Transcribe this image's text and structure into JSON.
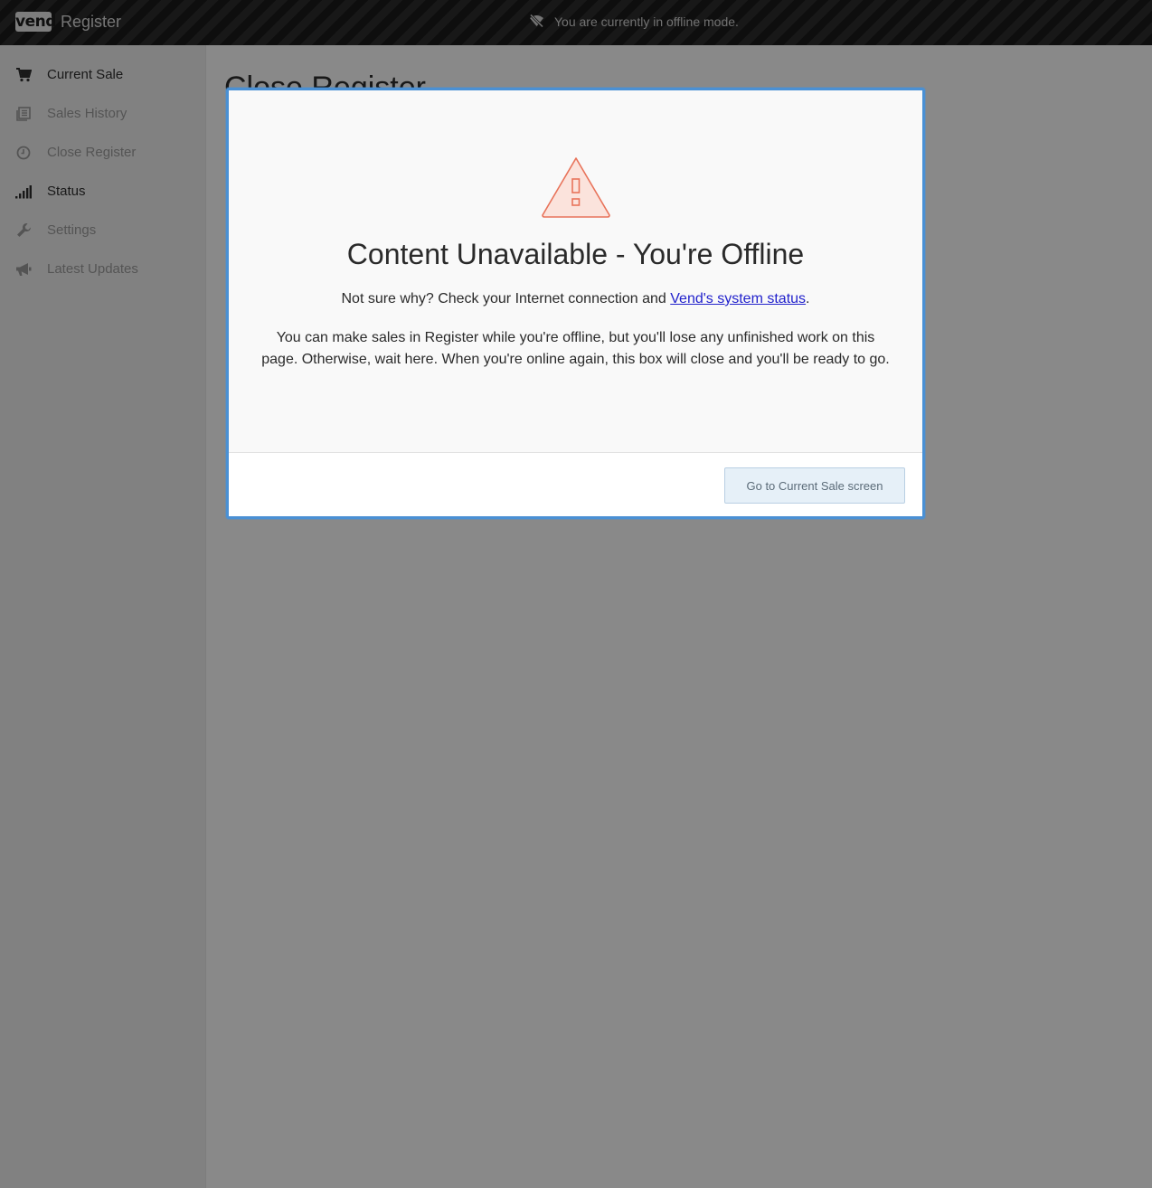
{
  "header": {
    "logo_text": "vend",
    "app_title": "Register",
    "offline_message": "You are currently in offline mode.",
    "offline_icon": "wifi-off-icon"
  },
  "sidebar": {
    "items": [
      {
        "label": "Current Sale",
        "icon": "cart-icon",
        "active": true
      },
      {
        "label": "Sales History",
        "icon": "history-list-icon",
        "active": false
      },
      {
        "label": "Close Register",
        "icon": "clock-icon",
        "active": false
      },
      {
        "label": "Status",
        "icon": "signal-bars-icon",
        "active": true
      },
      {
        "label": "Settings",
        "icon": "wrench-icon",
        "active": false
      },
      {
        "label": "Latest Updates",
        "icon": "megaphone-icon",
        "active": false
      }
    ]
  },
  "main": {
    "page_title": "Close Register"
  },
  "modal": {
    "icon": "warning-triangle-icon",
    "heading": "Content Unavailable - You're Offline",
    "line1_prefix": "Not sure why? Check your Internet connection and ",
    "line1_link": "Vend's system status",
    "line1_suffix": ".",
    "line2": "You can make sales in Register while you're offline, but you'll lose any unfinished work on this page. Otherwise, wait here. When you're online again, this box will close and you'll be ready to go.",
    "button_label": "Go to Current Sale screen"
  },
  "colors": {
    "modal_border": "#4a90d4",
    "warning_stroke": "#e8735a",
    "warning_fill": "#fbe3dc",
    "overlay": "rgba(0,0,0,0.45)"
  }
}
